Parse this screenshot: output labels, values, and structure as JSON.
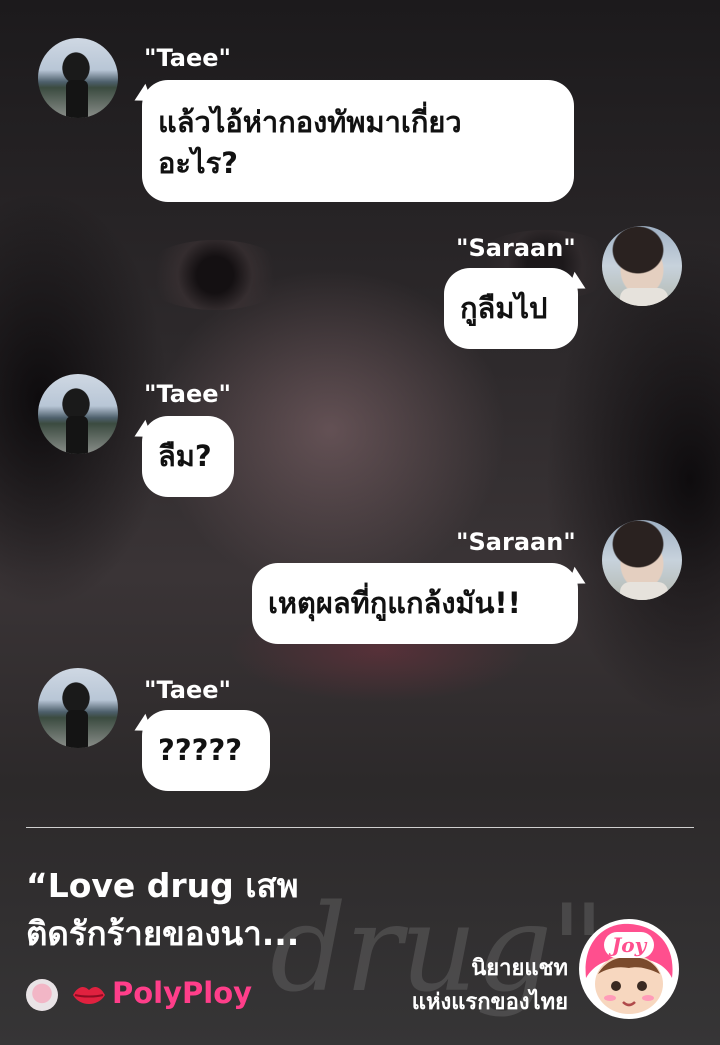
{
  "messages": [
    {
      "sender": "\"Taee\"",
      "side": "left",
      "text_lines": [
        "แล้วไอ้ห่ากองทัพมาเกี่ยว",
        "อะไร?"
      ]
    },
    {
      "sender": "\"Saraan\"",
      "side": "right",
      "text_lines": [
        "กูลืมไป"
      ]
    },
    {
      "sender": "\"Taee\"",
      "side": "left",
      "text_lines": [
        "ลืม?"
      ]
    },
    {
      "sender": "\"Saraan\"",
      "side": "right",
      "text_lines": [
        "เหตุผลที่กูแกล้งมัน!!"
      ]
    },
    {
      "sender": "\"Taee\"",
      "side": "left",
      "text_lines": [
        "?????"
      ]
    }
  ],
  "footer": {
    "title_lines": [
      "“Love drug เสพ",
      "ติดรักร้ายของนา..."
    ],
    "author": "PolyPloy",
    "tagline_lines": [
      "นิยายแชท",
      "แห่งแรกของไทย"
    ],
    "logo_text": "Joy"
  },
  "colors": {
    "bubble": "#ffffff",
    "author": "#ff3e8a",
    "logo_pink": "#ff4f8e"
  }
}
